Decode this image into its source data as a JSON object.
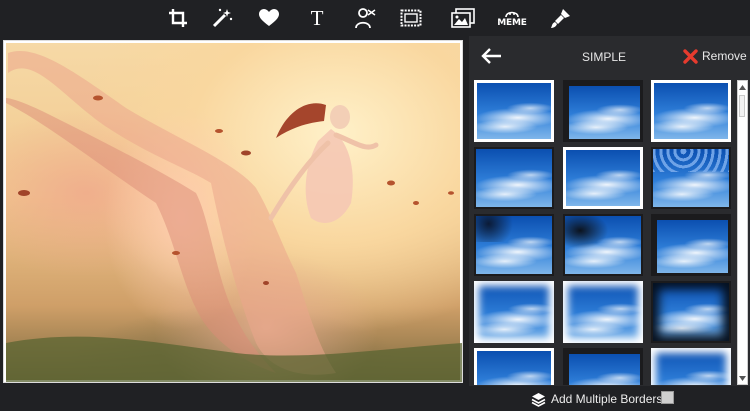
{
  "toolbar": {
    "tools": [
      {
        "icon": "crop-icon"
      },
      {
        "icon": "magic-wand-icon"
      },
      {
        "icon": "heart-icon"
      },
      {
        "icon": "text-icon",
        "glyph": "T"
      },
      {
        "icon": "cutout-person-icon"
      },
      {
        "icon": "border-frame-icon"
      },
      {
        "icon": "photo-icon"
      },
      {
        "icon": "meme-icon",
        "label": "MEME"
      },
      {
        "icon": "paint-brush-icon"
      }
    ]
  },
  "panel": {
    "title": "SIMPLE",
    "remove_label": "Remove",
    "accent_color": "#e63b2e"
  },
  "border_styles": [
    "white-thin",
    "black-thick",
    "white-thin",
    "black-thick",
    "white-rounded",
    "floral",
    "ornate-dark",
    "splash-black",
    "black-corner",
    "rough-white",
    "rough-white",
    "vignette-dark",
    "white-thin",
    "black-thick",
    "rough-white"
  ],
  "footer": {
    "add_multiple_label": "Add Multiple Borders",
    "add_multiple_checked": false
  },
  "colors": {
    "background": "#202124",
    "panel": "#2a2b2e",
    "text": "#ffffff"
  }
}
